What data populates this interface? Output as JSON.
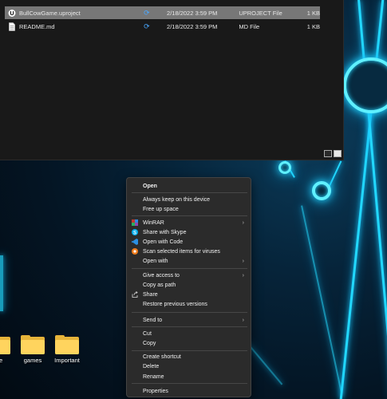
{
  "explorer": {
    "files": [
      {
        "name": "BullCowGame.uproject",
        "date": "2/18/2022 3:59 PM",
        "type": "UPROJECT File",
        "size": "1 KB",
        "status_icon": "sync-icon",
        "selected": true
      },
      {
        "name": "README.md",
        "date": "2/18/2022 3:59 PM",
        "type": "MD File",
        "size": "1 KB",
        "status_icon": "sync-icon",
        "selected": false
      }
    ]
  },
  "context_menu": {
    "open": "Open",
    "always_keep": "Always keep on this device",
    "free_up_space": "Free up space",
    "winrar": "WinRAR",
    "share_skype": "Share with Skype",
    "open_with_code": "Open with Code",
    "scan_viruses": "Scan selected items for viruses",
    "open_with": "Open with",
    "give_access": "Give access to",
    "copy_as_path": "Copy as path",
    "share": "Share",
    "restore_versions": "Restore previous versions",
    "send_to": "Send to",
    "cut": "Cut",
    "copy": "Copy",
    "create_shortcut": "Create shortcut",
    "delete": "Delete",
    "rename": "Rename",
    "properties": "Properties"
  },
  "desktop": {
    "folders": [
      "ate",
      "games",
      "Important"
    ]
  },
  "colors": {
    "accent_glow": "#22d8ff",
    "menu_bg": "#2b2b2b",
    "folder_yellow": "#ffd45e",
    "sync_blue": "#4aa8ff"
  }
}
